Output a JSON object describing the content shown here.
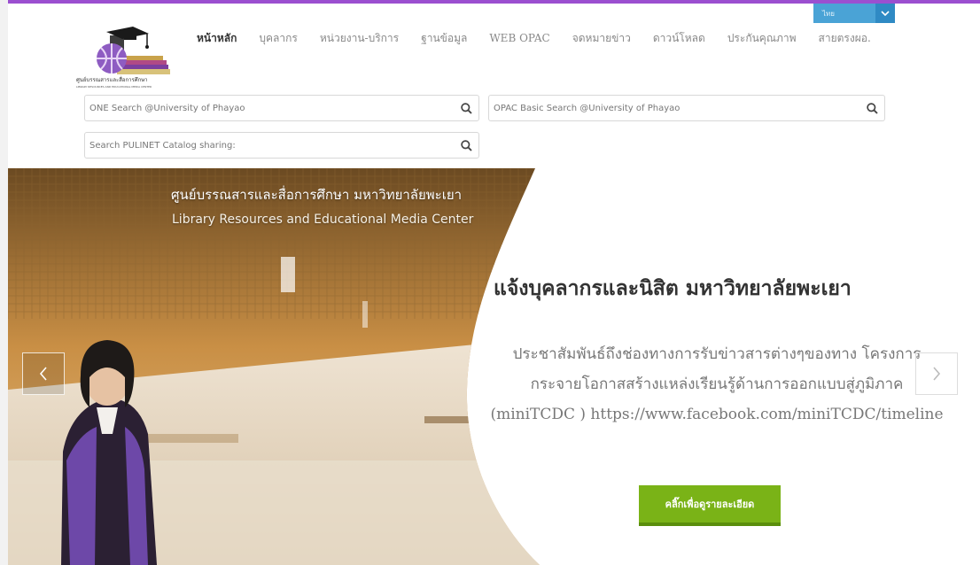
{
  "header": {
    "logo_title": "ศูนย์บรรณสารและสื่อการศึกษา",
    "logo_subtitle": "LIBRARY RESOURCES AND EDUCATIONAL MEDIA CENTER",
    "language": "ไทย",
    "nav": [
      {
        "label": "หน้าหลัก",
        "active": true
      },
      {
        "label": "บุคลากร"
      },
      {
        "label": "หน่วยงาน-บริการ"
      },
      {
        "label": "ฐานข้อมูล"
      },
      {
        "label": "WEB OPAC"
      },
      {
        "label": "จดหมายข่าว"
      },
      {
        "label": "ดาวน์โหลด"
      },
      {
        "label": "ประกันคุณภาพ"
      },
      {
        "label": "สายตรงผอ."
      }
    ]
  },
  "search": {
    "one_search_placeholder": "ONE Search @University of Phayao",
    "opac_placeholder": "OPAC Basic Search @University of Phayao",
    "pulinet_placeholder": "Search PULINET Catalog sharing:"
  },
  "hero": {
    "photo_caption_th": "ศูนย์บรรณสารและสื่อการศึกษา มหาวิทยาลัยพะเยา",
    "photo_caption_en": "Library Resources and Educational Media Center",
    "headline": "แจ้งบุคลากรและนิสิต มหาวิทยาลัยพะเยา",
    "body_line1": "ประชาสัมพันธ์ถึงช่องทางการรับข่าวสารต่างๆของทาง โครงการ",
    "body_line2": "กระจายโอกาสสร้างแหล่งเรียนรู้ด้านการออกแบบสู่ภูมิภาค",
    "body_line3": "(miniTCDC ) https://www.facebook.com/miniTCDC/timeline",
    "cta_label": "คลิ๊กเพื่อดูรายละเอียด"
  },
  "colors": {
    "accent_top": "#9b4fd0",
    "language_bg": "#4aa3d6",
    "cta_green": "#7ab317"
  }
}
